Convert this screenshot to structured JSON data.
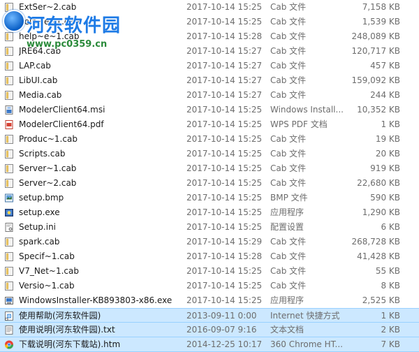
{
  "watermark": {
    "title": "河东软件园",
    "url": "www.pc0359.cn"
  },
  "files": [
    {
      "name": "ExtSer~2.cab",
      "date": "2017-10-14 15:25",
      "type": "Cab 文件",
      "size": "7,158 KB",
      "icon": "cab-file-icon",
      "selected": false
    },
    {
      "name": "help~e~1.cab",
      "date": "2017-10-14 15:25",
      "type": "Cab 文件",
      "size": "1,539 KB",
      "icon": "cab-file-icon",
      "selected": false
    },
    {
      "name": "help~e~1.cab",
      "date": "2017-10-14 15:28",
      "type": "Cab 文件",
      "size": "248,089 KB",
      "icon": "cab-file-icon",
      "selected": false
    },
    {
      "name": "JRE64.cab",
      "date": "2017-10-14 15:27",
      "type": "Cab 文件",
      "size": "120,717 KB",
      "icon": "cab-file-icon",
      "selected": false
    },
    {
      "name": "LAP.cab",
      "date": "2017-10-14 15:27",
      "type": "Cab 文件",
      "size": "457 KB",
      "icon": "cab-file-icon",
      "selected": false
    },
    {
      "name": "LibUI.cab",
      "date": "2017-10-14 15:27",
      "type": "Cab 文件",
      "size": "159,092 KB",
      "icon": "cab-file-icon",
      "selected": false
    },
    {
      "name": "Media.cab",
      "date": "2017-10-14 15:27",
      "type": "Cab 文件",
      "size": "244 KB",
      "icon": "cab-file-icon",
      "selected": false
    },
    {
      "name": "ModelerClient64.msi",
      "date": "2017-10-14 15:25",
      "type": "Windows Install...",
      "size": "10,352 KB",
      "icon": "msi-installer-icon",
      "selected": false
    },
    {
      "name": "ModelerClient64.pdf",
      "date": "2017-10-14 15:25",
      "type": "WPS PDF 文档",
      "size": "1 KB",
      "icon": "pdf-file-icon",
      "selected": false
    },
    {
      "name": "Produc~1.cab",
      "date": "2017-10-14 15:25",
      "type": "Cab 文件",
      "size": "19 KB",
      "icon": "cab-file-icon",
      "selected": false
    },
    {
      "name": "Scripts.cab",
      "date": "2017-10-14 15:25",
      "type": "Cab 文件",
      "size": "20 KB",
      "icon": "cab-file-icon",
      "selected": false
    },
    {
      "name": "Server~1.cab",
      "date": "2017-10-14 15:25",
      "type": "Cab 文件",
      "size": "919 KB",
      "icon": "cab-file-icon",
      "selected": false
    },
    {
      "name": "Server~2.cab",
      "date": "2017-10-14 15:25",
      "type": "Cab 文件",
      "size": "22,680 KB",
      "icon": "cab-file-icon",
      "selected": false
    },
    {
      "name": "setup.bmp",
      "date": "2017-10-14 15:25",
      "type": "BMP 文件",
      "size": "590 KB",
      "icon": "bmp-image-icon",
      "selected": false
    },
    {
      "name": "setup.exe",
      "date": "2017-10-14 15:25",
      "type": "应用程序",
      "size": "1,290 KB",
      "icon": "exe-application-icon",
      "selected": false
    },
    {
      "name": "Setup.ini",
      "date": "2017-10-14 15:25",
      "type": "配置设置",
      "size": "6 KB",
      "icon": "ini-settings-icon",
      "selected": false
    },
    {
      "name": "spark.cab",
      "date": "2017-10-14 15:29",
      "type": "Cab 文件",
      "size": "268,728 KB",
      "icon": "cab-file-icon",
      "selected": false
    },
    {
      "name": "Specif~1.cab",
      "date": "2017-10-14 15:28",
      "type": "Cab 文件",
      "size": "41,428 KB",
      "icon": "cab-file-icon",
      "selected": false
    },
    {
      "name": "V7_Net~1.cab",
      "date": "2017-10-14 15:25",
      "type": "Cab 文件",
      "size": "55 KB",
      "icon": "cab-file-icon",
      "selected": false
    },
    {
      "name": "Versio~1.cab",
      "date": "2017-10-14 15:25",
      "type": "Cab 文件",
      "size": "8 KB",
      "icon": "cab-file-icon",
      "selected": false
    },
    {
      "name": "WindowsInstaller-KB893803-x86.exe",
      "date": "2017-10-14 15:25",
      "type": "应用程序",
      "size": "2,525 KB",
      "icon": "installer-exe-icon",
      "selected": false
    },
    {
      "name": "使用帮助(河东软件园)",
      "date": "2013-09-11 0:00",
      "type": "Internet 快捷方式",
      "size": "1 KB",
      "icon": "internet-shortcut-icon",
      "selected": true
    },
    {
      "name": "使用说明(河东软件园).txt",
      "date": "2016-09-07 9:16",
      "type": "文本文档",
      "size": "2 KB",
      "icon": "text-document-icon",
      "selected": true
    },
    {
      "name": "下载说明(河东下载站).htm",
      "date": "2014-12-25 10:17",
      "type": "360 Chrome HT...",
      "size": "7 KB",
      "icon": "chrome-html-icon",
      "selected": true
    }
  ]
}
